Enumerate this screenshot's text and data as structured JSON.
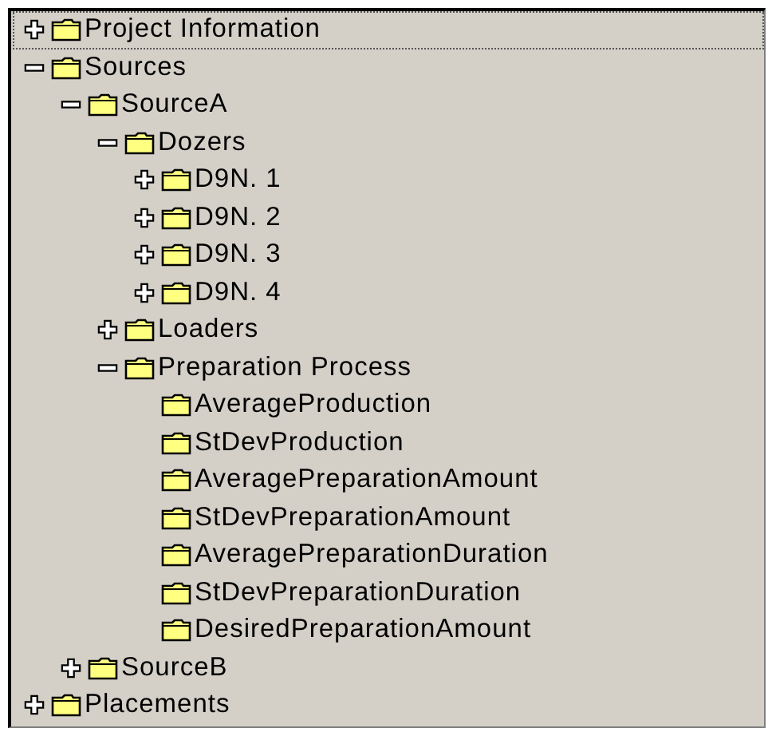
{
  "tree": [
    {
      "label": "Project Information",
      "kind": "branch",
      "expanded": false,
      "selected": true
    },
    {
      "label": "Sources",
      "kind": "branch",
      "expanded": true,
      "selected": false,
      "children": [
        {
          "label": "SourceA",
          "kind": "branch",
          "expanded": true,
          "selected": false,
          "children": [
            {
              "label": "Dozers",
              "kind": "branch",
              "expanded": true,
              "selected": false,
              "children": [
                {
                  "label": "D9N. 1",
                  "kind": "branch",
                  "expanded": false,
                  "selected": false
                },
                {
                  "label": "D9N. 2",
                  "kind": "branch",
                  "expanded": false,
                  "selected": false
                },
                {
                  "label": "D9N. 3",
                  "kind": "branch",
                  "expanded": false,
                  "selected": false
                },
                {
                  "label": "D9N. 4",
                  "kind": "branch",
                  "expanded": false,
                  "selected": false
                }
              ]
            },
            {
              "label": "Loaders",
              "kind": "branch",
              "expanded": false,
              "selected": false
            },
            {
              "label": "Preparation Process",
              "kind": "branch",
              "expanded": true,
              "selected": false,
              "children": [
                {
                  "label": "AverageProduction",
                  "kind": "leaf",
                  "selected": false
                },
                {
                  "label": "StDevProduction",
                  "kind": "leaf",
                  "selected": false
                },
                {
                  "label": "AveragePreparationAmount",
                  "kind": "leaf",
                  "selected": false
                },
                {
                  "label": "StDevPreparationAmount",
                  "kind": "leaf",
                  "selected": false
                },
                {
                  "label": "AveragePreparationDuration",
                  "kind": "leaf",
                  "selected": false
                },
                {
                  "label": "StDevPreparationDuration",
                  "kind": "leaf",
                  "selected": false
                },
                {
                  "label": "DesiredPreparationAmount",
                  "kind": "leaf",
                  "selected": false
                }
              ]
            }
          ]
        },
        {
          "label": "SourceB",
          "kind": "branch",
          "expanded": false,
          "selected": false
        }
      ]
    },
    {
      "label": "Placements",
      "kind": "branch",
      "expanded": false,
      "selected": false
    }
  ]
}
